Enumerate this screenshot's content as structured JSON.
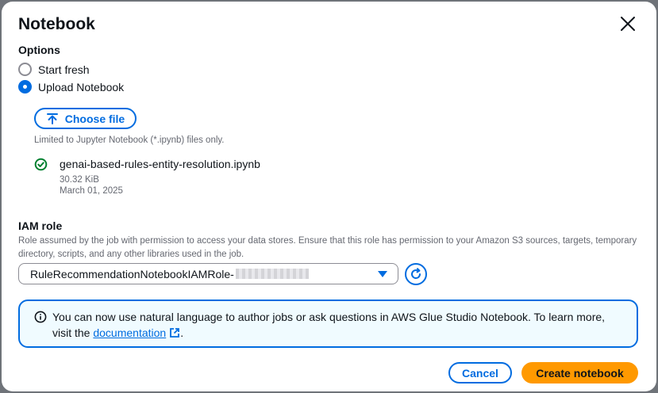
{
  "modal": {
    "title": "Notebook",
    "close_icon": "close-icon"
  },
  "options": {
    "label": "Options",
    "radios": [
      {
        "label": "Start fresh",
        "checked": false
      },
      {
        "label": "Upload Notebook",
        "checked": true
      }
    ],
    "choose_file_label": "Choose file",
    "choose_file_icon": "upload-icon",
    "hint": "Limited to Jupyter Notebook (*.ipynb) files only.",
    "file": {
      "status_icon": "success-check-icon",
      "name": "genai-based-rules-entity-resolution.ipynb",
      "size": "30.32 KiB",
      "date": "March 01, 2025"
    }
  },
  "iam": {
    "label": "IAM role",
    "description": "Role assumed by the job with permission to access your data stores. Ensure that this role has permission to your Amazon S3 sources, targets, temporary directory, scripts, and any other libraries used in the job.",
    "selected_value": "RuleRecommendationNotebookIAMRole-",
    "refresh_icon": "refresh-icon"
  },
  "info": {
    "icon": "info-icon",
    "text_before": "You can now use natural language to author jobs or ask questions in AWS Glue Studio Notebook. To learn more, visit the ",
    "link_text": "documentation",
    "text_after": ".",
    "link_icon": "external-link-icon"
  },
  "footer": {
    "cancel_label": "Cancel",
    "create_label": "Create notebook"
  },
  "colors": {
    "accent": "#006ce0",
    "primary_button": "#ff9900",
    "success": "#00802f",
    "info_bg": "#f0fbff"
  }
}
